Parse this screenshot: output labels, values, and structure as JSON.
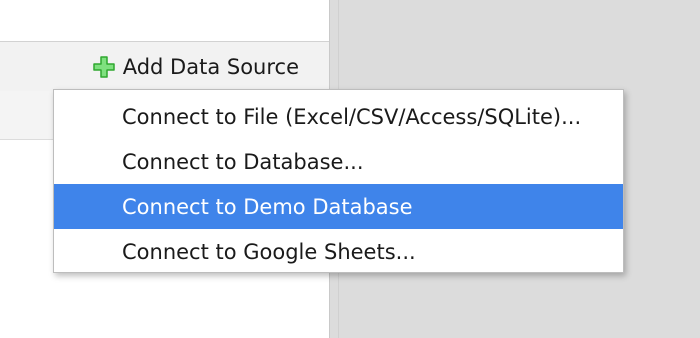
{
  "toolbar": {
    "add_data_source_label": "Add Data Source",
    "add_icon": "plus-icon",
    "add_icon_color": "#3cc23c"
  },
  "dropdown": {
    "items": [
      {
        "label": "Connect to File (Excel/CSV/Access/SQLite)...",
        "selected": false
      },
      {
        "label": "Connect to Database...",
        "selected": false
      },
      {
        "label": "Connect to Demo Database",
        "selected": true
      },
      {
        "label": "Connect to Google Sheets...",
        "selected": false
      }
    ],
    "selected_color": "#3f84ea"
  }
}
